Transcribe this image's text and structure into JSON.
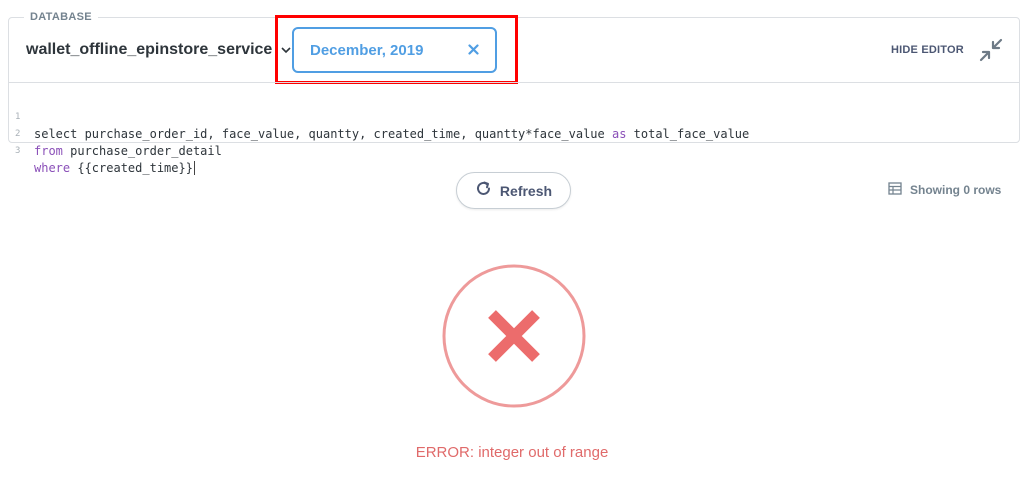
{
  "editor": {
    "database_label": "DATABASE",
    "database_name": "wallet_offline_epinstore_service",
    "filter_value": "December, 2019",
    "hide_editor_label": "HIDE EDITOR",
    "code_lines": [
      {
        "num": "1",
        "parts": [
          "select purchase_order_id, face_value, quantty, created_time, quantty*face_value ",
          "as",
          " total_face_value"
        ]
      },
      {
        "num": "2",
        "parts": [
          "from",
          " purchase_order_detail"
        ]
      },
      {
        "num": "3",
        "parts": [
          "where",
          " {{created_time}}"
        ]
      }
    ]
  },
  "toolbar": {
    "refresh_label": "Refresh",
    "row_count_label": "Showing 0 rows"
  },
  "result": {
    "error_message": "ERROR: integer out of range"
  },
  "icons": {
    "filter_close": "close-icon",
    "collapse": "collapse-icon",
    "refresh": "refresh-icon",
    "table": "table-icon",
    "error": "error-x-icon",
    "dropdown": "chevron-down-icon"
  },
  "colors": {
    "accent": "#509ee3",
    "highlight": "#ff0000",
    "error": "#e06a6a",
    "keyword": "#8a4fb8"
  }
}
